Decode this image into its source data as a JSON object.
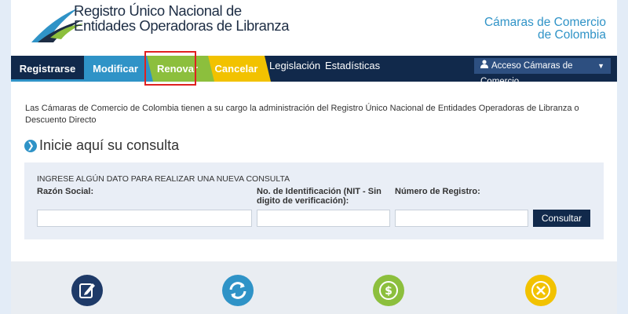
{
  "header": {
    "title_line1": "Registro Único Nacional de",
    "title_line2": "Entidades Operadoras de Libranza",
    "chambers_line1": "Cámaras de Comercio",
    "chambers_line2": "de Colombia"
  },
  "nav": {
    "register": "Registrarse",
    "modify": "Modificar",
    "renew": "Renovar",
    "cancel": "Cancelar",
    "legislation": "Legislación",
    "statistics": "Estadísticas",
    "access": "Acceso Cámaras de Comercio"
  },
  "intro": "Las Cámaras de Comercio de Colombia tienen a su cargo la administración del Registro Único Nacional de Entidades Operadoras de Libranza o Descuento Directo",
  "consult": {
    "title": "Inicie aquí su consulta",
    "heading": "INGRESE ALGÚN DATO PARA REALIZAR UNA NUEVA CONSULTA",
    "razon_label": "Razón Social:",
    "nit_label": "No. de Identificación (NIT - Sin digito de verificación):",
    "registro_label": "Número de Registro:",
    "razon_value": "",
    "nit_value": "",
    "registro_value": "",
    "button": "Consultar"
  },
  "colors": {
    "navy": "#11294b",
    "blue": "#2f93c7",
    "green": "#8cbf3d",
    "yellow": "#f2c200",
    "highlight": "#e02020"
  }
}
